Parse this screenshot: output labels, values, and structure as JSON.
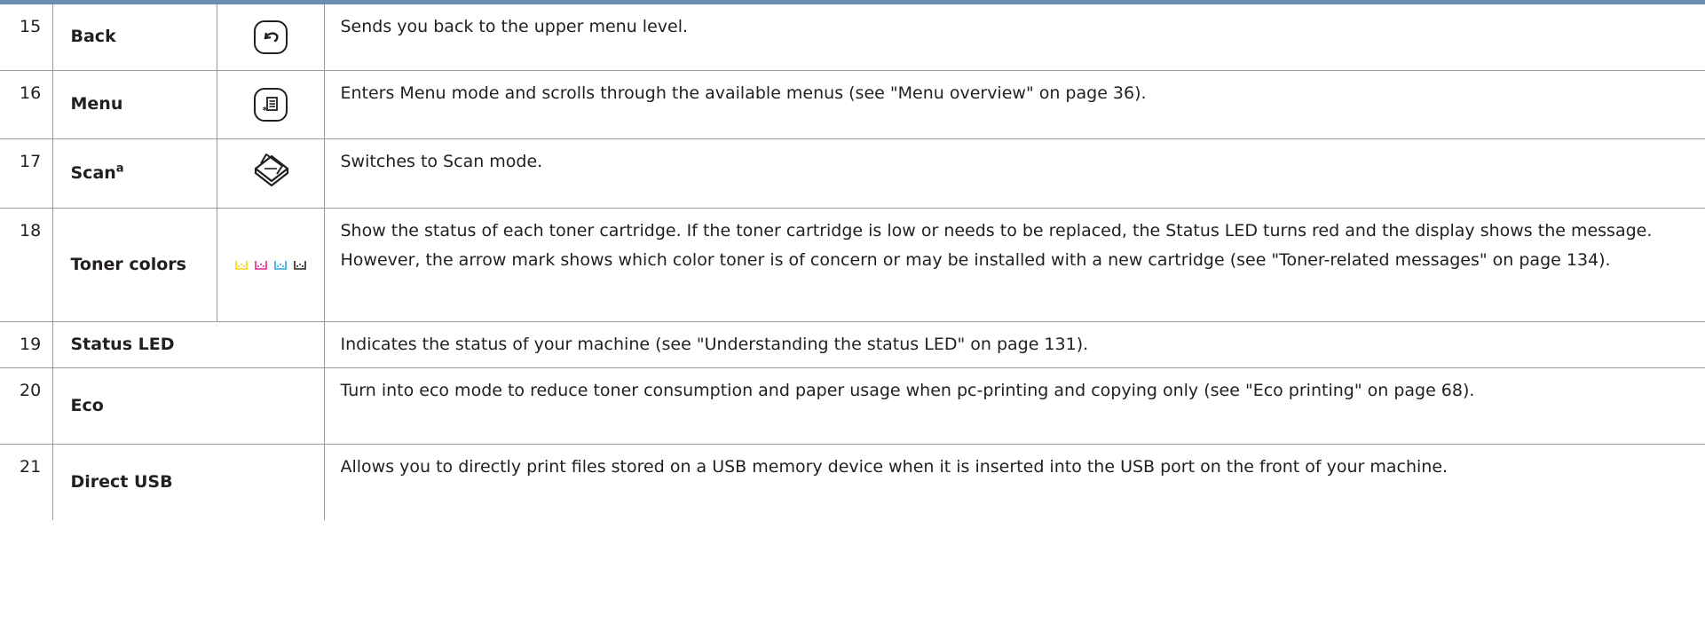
{
  "rows": [
    {
      "num": "15",
      "name": "Back",
      "icon": "back-arrow-icon",
      "desc": "Sends you back to the upper menu level."
    },
    {
      "num": "16",
      "name": "Menu",
      "icon": "menu-list-icon",
      "desc": "Enters Menu mode and scrolls through the available menus (see \"Menu overview\" on page 36)."
    },
    {
      "num": "17",
      "name": "Scan",
      "name_sup": "a",
      "icon": "scanner-icon",
      "desc": "Switches to Scan mode."
    },
    {
      "num": "18",
      "name": "Toner colors",
      "icon": "toner-indicators-icon",
      "desc": "Show the status of each toner cartridge. If the toner cartridge is low or needs to be replaced, the Status LED turns red and the display shows the message. However, the arrow mark shows which color toner is of concern or may be installed with a new cartridge (see \"Toner-related messages\" on page 134)."
    },
    {
      "num": "19",
      "name": "Status LED",
      "desc": "Indicates the status of your machine (see \"Understanding the status LED\" on page 131)."
    },
    {
      "num": "20",
      "name": "Eco",
      "desc": "Turn into eco mode to reduce toner consumption and paper usage when pc-printing and copying only (see \"Eco printing\" on page 68)."
    },
    {
      "num": "21",
      "name": "Direct USB",
      "desc": "Allows you to directly print files stored on a USB memory device when it is inserted into the USB port on the front of your machine."
    }
  ],
  "colors": {
    "header_rule": "#6b8fb3",
    "grid": "#9a9a9a",
    "text": "#231f20",
    "toner": [
      "#f2d600",
      "#e0238a",
      "#2aa7e0",
      "#231f20"
    ]
  }
}
